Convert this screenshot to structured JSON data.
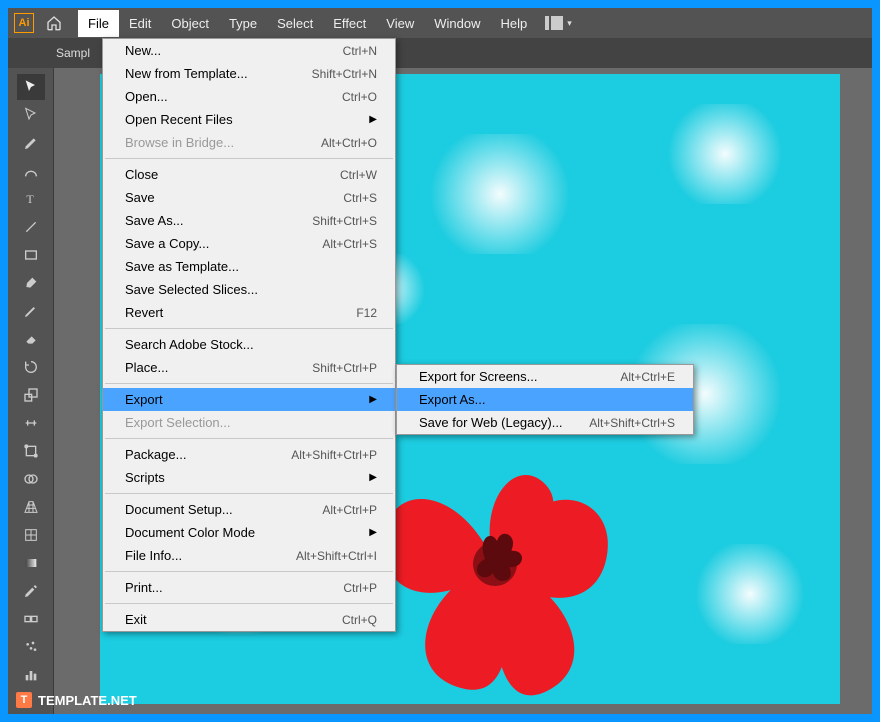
{
  "app": {
    "logo_text": "Ai"
  },
  "menubar": [
    "File",
    "Edit",
    "Object",
    "Type",
    "Select",
    "Effect",
    "View",
    "Window",
    "Help"
  ],
  "tab": {
    "name": "Sampl"
  },
  "file_menu": [
    {
      "label": "New...",
      "shortcut": "Ctrl+N"
    },
    {
      "label": "New from Template...",
      "shortcut": "Shift+Ctrl+N"
    },
    {
      "label": "Open...",
      "shortcut": "Ctrl+O"
    },
    {
      "label": "Open Recent Files",
      "submenu": true
    },
    {
      "label": "Browse in Bridge...",
      "shortcut": "Alt+Ctrl+O",
      "disabled": true
    },
    {
      "sep": true
    },
    {
      "label": "Close",
      "shortcut": "Ctrl+W"
    },
    {
      "label": "Save",
      "shortcut": "Ctrl+S"
    },
    {
      "label": "Save As...",
      "shortcut": "Shift+Ctrl+S"
    },
    {
      "label": "Save a Copy...",
      "shortcut": "Alt+Ctrl+S"
    },
    {
      "label": "Save as Template..."
    },
    {
      "label": "Save Selected Slices..."
    },
    {
      "label": "Revert",
      "shortcut": "F12"
    },
    {
      "sep": true
    },
    {
      "label": "Search Adobe Stock..."
    },
    {
      "label": "Place...",
      "shortcut": "Shift+Ctrl+P"
    },
    {
      "sep": true
    },
    {
      "label": "Export",
      "submenu": true,
      "highlight": true
    },
    {
      "label": "Export Selection...",
      "disabled": true
    },
    {
      "sep": true
    },
    {
      "label": "Package...",
      "shortcut": "Alt+Shift+Ctrl+P"
    },
    {
      "label": "Scripts",
      "submenu": true
    },
    {
      "sep": true
    },
    {
      "label": "Document Setup...",
      "shortcut": "Alt+Ctrl+P"
    },
    {
      "label": "Document Color Mode",
      "submenu": true
    },
    {
      "label": "File Info...",
      "shortcut": "Alt+Shift+Ctrl+I"
    },
    {
      "sep": true
    },
    {
      "label": "Print...",
      "shortcut": "Ctrl+P"
    },
    {
      "sep": true
    },
    {
      "label": "Exit",
      "shortcut": "Ctrl+Q"
    }
  ],
  "export_submenu": [
    {
      "label": "Export for Screens...",
      "shortcut": "Alt+Ctrl+E"
    },
    {
      "label": "Export As...",
      "highlight": true
    },
    {
      "label": "Save for Web (Legacy)...",
      "shortcut": "Alt+Shift+Ctrl+S"
    }
  ],
  "tools": [
    "selection",
    "direct-select",
    "pen",
    "curvature",
    "type",
    "line",
    "rectangle",
    "brush",
    "pencil",
    "eraser",
    "rotate",
    "scale",
    "width",
    "free-transform",
    "shape-builder",
    "perspective",
    "mesh",
    "gradient",
    "eyedropper",
    "blend",
    "symbol",
    "column-graph"
  ],
  "watermark": "TEMPLATE.NET"
}
